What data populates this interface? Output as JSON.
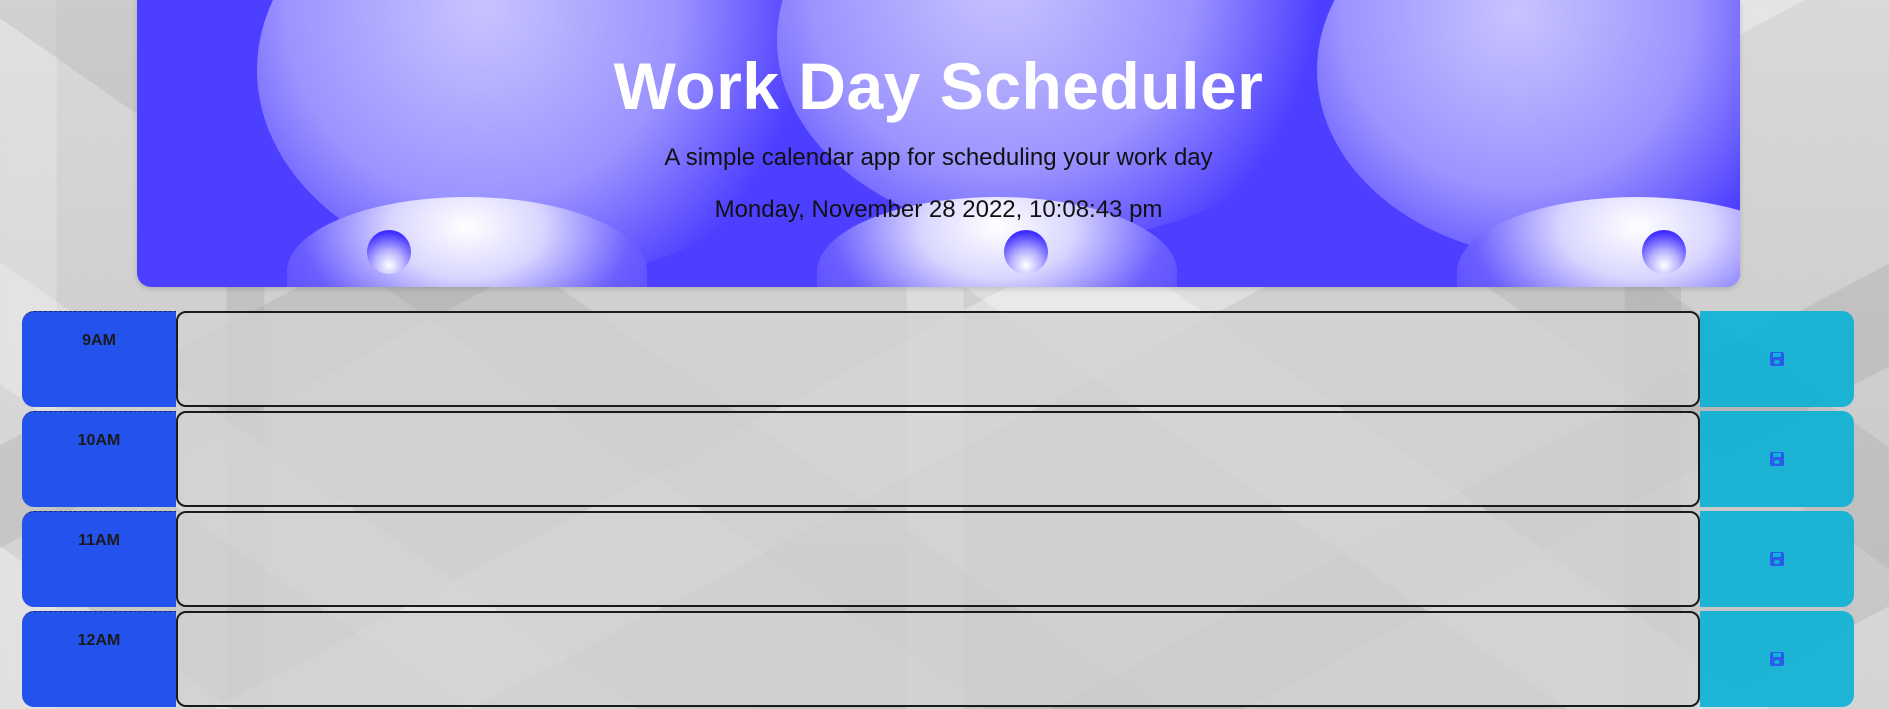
{
  "header": {
    "title": "Work Day Scheduler",
    "subtitle": "A simple calendar app for scheduling your work day",
    "current_day": "Monday, November 28 2022, 10:08:43 pm"
  },
  "schedule": {
    "rows": [
      {
        "hour": "9AM",
        "description": "",
        "save_icon": "save-icon"
      },
      {
        "hour": "10AM",
        "description": "",
        "save_icon": "save-icon"
      },
      {
        "hour": "11AM",
        "description": "",
        "save_icon": "save-icon"
      },
      {
        "hour": "12AM",
        "description": "",
        "save_icon": "save-icon"
      }
    ]
  },
  "colors": {
    "header_background": "#4d3fff",
    "hour_background": "#2452ec",
    "save_button": "#0ab0d6",
    "title_text": "#ffffff"
  }
}
